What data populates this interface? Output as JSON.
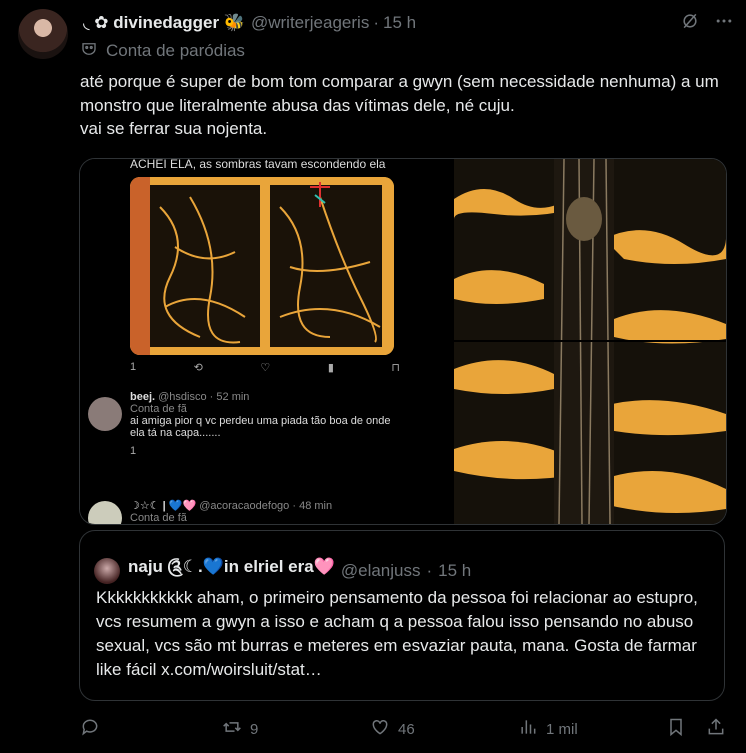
{
  "post": {
    "display_name": "◟ ✿ divinedagger 🐝",
    "handle": "@writerjeageris",
    "separator": "·",
    "time": "15 h",
    "badge_icon": "mask-icon",
    "badge_label": "Conta de paródias",
    "text": "até porque é super de bom tom comparar a gwyn (sem necessidade nenhuma) a um monstro que literalmente abusa das vítimas dele, né cuju.\nvai se ferrar sua nojenta."
  },
  "media": {
    "embed_caption": "ACHEI ELA, as sombras tavam escondendo ela",
    "embed_counts": [
      "1",
      "",
      "",
      "",
      ""
    ],
    "reply1": {
      "name": "beej.",
      "handle": "@hsdisco",
      "time": "52 min",
      "badge": "Conta de fã",
      "text": "ai amiga pior q vc perdeu uma piada tão boa de onde ela tá na capa.......",
      "count": "1"
    },
    "reply2": {
      "name": "☽☆☾ | 💙🩷",
      "handle": "@acoracaodefogo",
      "time": "48 min",
      "badge": "Conta de fã"
    }
  },
  "quote": {
    "display_name": "naju ༊☾.💙in elriel era🩷",
    "handle": "@elanjuss",
    "separator": "·",
    "time": "15 h",
    "text": "Kkkkkkkkkkk aham, o primeiro pensamento da pessoa foi relacionar ao estupro, vcs resumem a gwyn a isso e acham q a pessoa falou isso pensando no abuso sexual, vcs são mt burras e meteres em esvaziar pauta, mana. Gosta de farmar like fácil x.com/woirsluit/stat…"
  },
  "actions": {
    "reply_count": "",
    "retweet_count": "9",
    "like_count": "46",
    "views_count": "1 mil"
  },
  "colors": {
    "background": "#000000",
    "text": "#e7e9ea",
    "muted": "#71767b",
    "border": "#2f3336",
    "art_yellow": "#e9a53a"
  }
}
